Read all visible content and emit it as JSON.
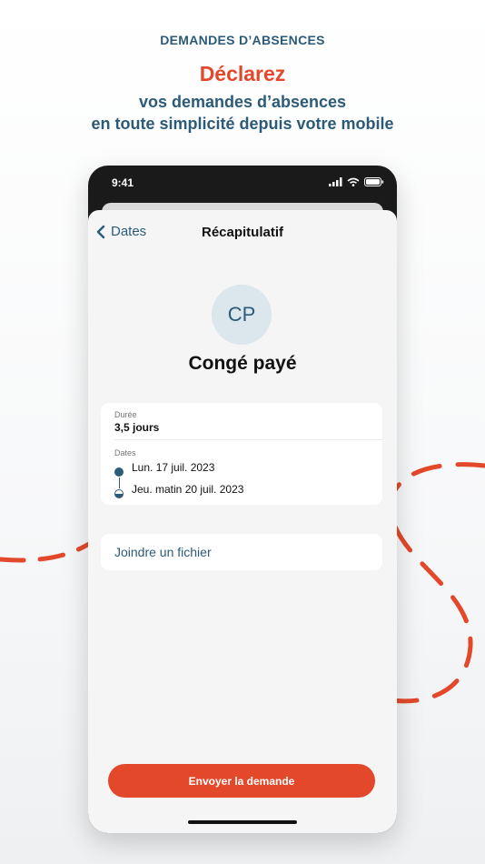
{
  "promo": {
    "kicker": "DEMANDES D’ABSENCES",
    "title": "Déclarez",
    "subtitle_line1": "vos demandes d’absences",
    "subtitle_line2": "en toute simplicité depuis votre mobile"
  },
  "colors": {
    "accent": "#e4482b",
    "primary": "#2b5b78"
  },
  "status_bar": {
    "time": "9:41",
    "icons": [
      "signal-icon",
      "wifi-icon",
      "battery-icon"
    ]
  },
  "nav": {
    "back_label": "Dates",
    "title": "Récapitulatif"
  },
  "absence": {
    "avatar_initials": "CP",
    "type": "Congé payé"
  },
  "details": {
    "duration_label": "Durée",
    "duration_value": "3,5 jours",
    "dates_label": "Dates",
    "start_date": "Lun. 17 juil. 2023",
    "end_date": "Jeu. matin 20 juil. 2023"
  },
  "attachment": {
    "label": "Joindre un fichier"
  },
  "actions": {
    "submit_label": "Envoyer la demande"
  }
}
